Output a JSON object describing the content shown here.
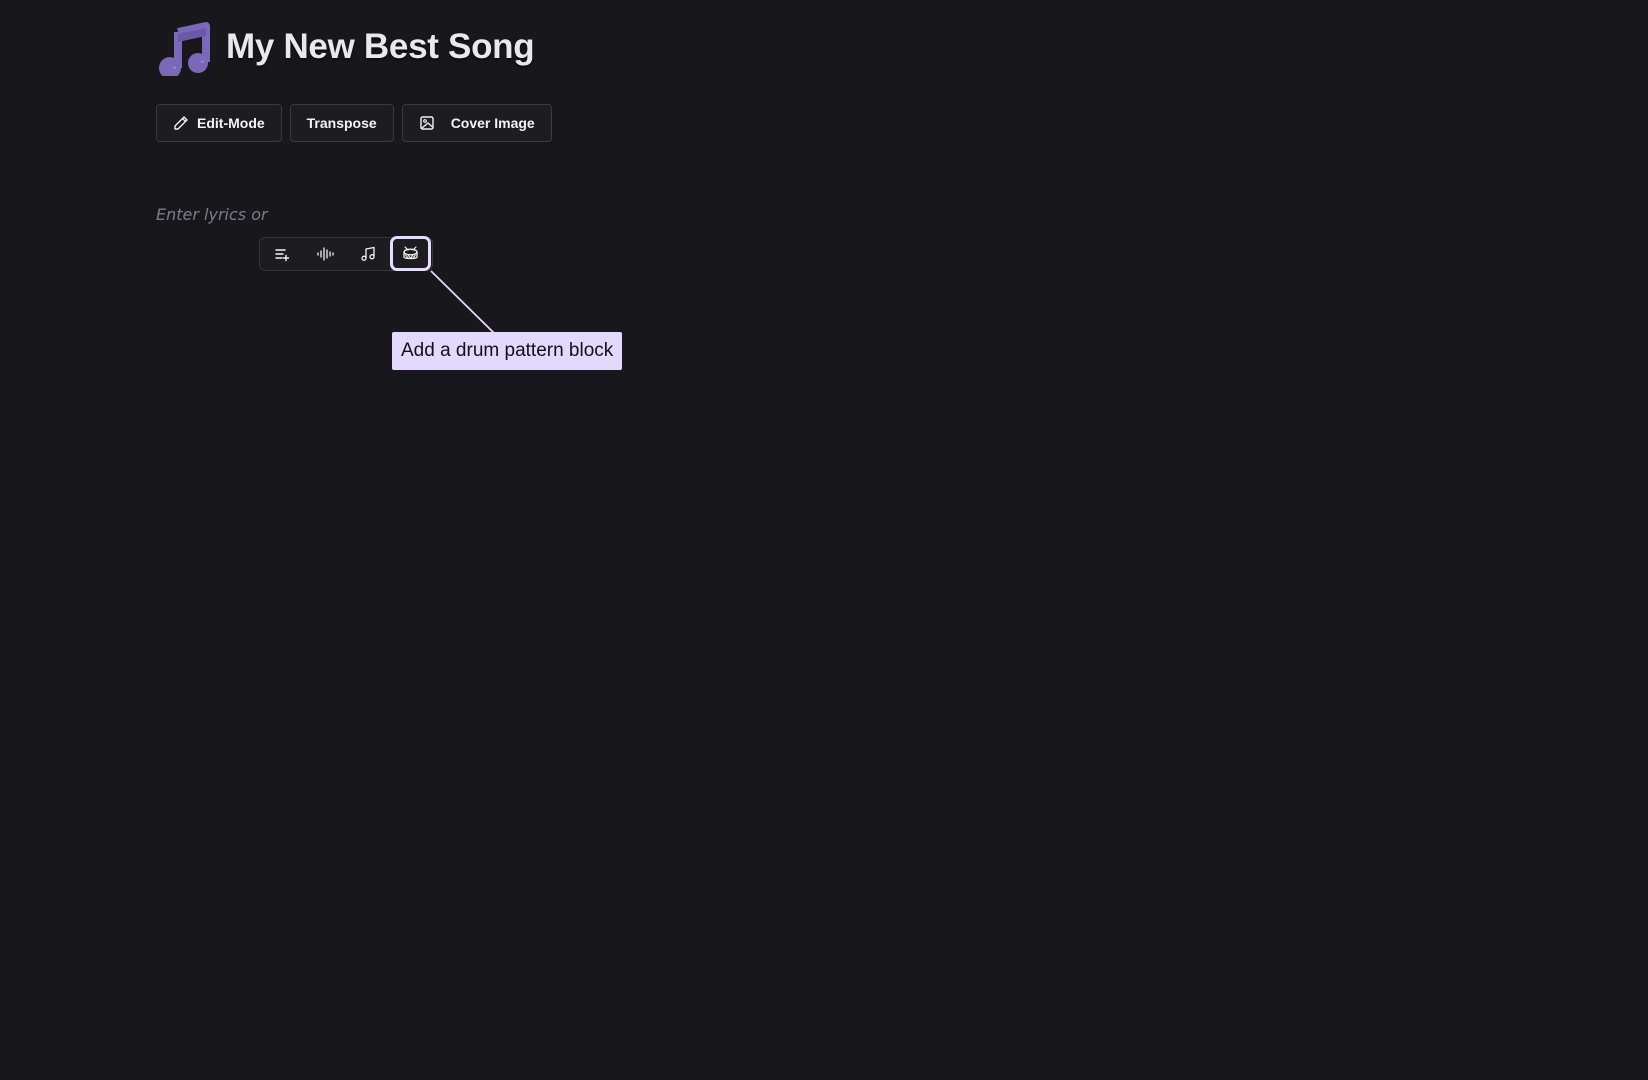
{
  "header": {
    "logo_icon": "music-note-icon",
    "title": "My New Best Song",
    "logo_color": "#7b68b8"
  },
  "toolbar": {
    "edit_mode": {
      "label": "Edit-Mode",
      "icon": "pencil-icon"
    },
    "transpose": {
      "label": "Transpose"
    },
    "cover_image": {
      "label": "Cover Image",
      "icon": "image-icon"
    }
  },
  "editor": {
    "placeholder": "Enter lyrics or"
  },
  "block_menu": {
    "items": [
      {
        "icon": "text-lines-add-icon"
      },
      {
        "icon": "audio-waveform-icon"
      },
      {
        "icon": "music-notes-icon"
      },
      {
        "icon": "drum-icon",
        "active": true
      }
    ],
    "active_color": "#e6dcff"
  },
  "tooltip": {
    "text": "Add a drum pattern block",
    "background": "#e3d9fd"
  }
}
